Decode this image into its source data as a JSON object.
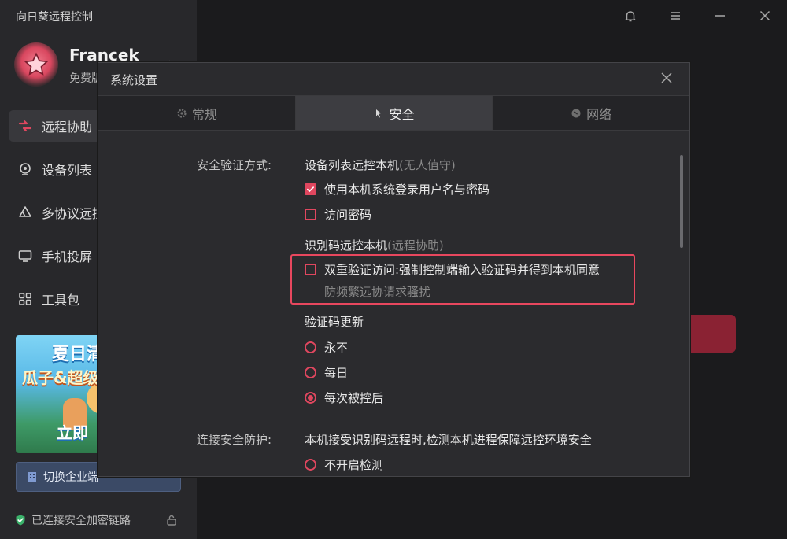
{
  "app": {
    "title": "向日葵远程控制"
  },
  "user": {
    "name": "Francek",
    "plan": "免费版"
  },
  "nav": [
    {
      "label": "远程协助",
      "icon": "remote-assist-icon",
      "active": true
    },
    {
      "label": "设备列表",
      "icon": "device-list-icon",
      "active": false
    },
    {
      "label": "多协议远控",
      "icon": "multi-protocol-icon",
      "active": false
    },
    {
      "label": "手机投屏",
      "icon": "screen-mirror-icon",
      "active": false
    },
    {
      "label": "工具包",
      "icon": "toolkit-icon",
      "active": false
    }
  ],
  "promo": {
    "line1": "夏日清",
    "line2": "瓜子&超级",
    "line3": "立即"
  },
  "switch_enterprise": {
    "label": "切换企业端"
  },
  "secure_status": {
    "label": "已连接安全加密链路"
  },
  "colors": {
    "accent": "#e0475f",
    "highlight": "#e8475e",
    "sidebar_bg": "#28282b",
    "modal_bg": "#2b2b2e"
  },
  "modal": {
    "title": "系统设置",
    "tabs": [
      {
        "label": "常规",
        "icon": "gear-icon",
        "active": false
      },
      {
        "label": "安全",
        "icon": "security-icon",
        "active": true
      },
      {
        "label": "网络",
        "icon": "globe-icon",
        "active": false
      }
    ],
    "security": {
      "verify_label": "安全验证方式:",
      "device_list_head": "设备列表远控本机",
      "device_list_hint": "(无人值守)",
      "opt_system_login": {
        "label": "使用本机系统登录用户名与密码",
        "checked": true
      },
      "opt_access_password": {
        "label": "访问密码",
        "checked": false
      },
      "code_head": "识别码远控本机",
      "code_hint": "(远程协助)",
      "opt_two_factor": {
        "label": "双重验证访问:强制控制端输入验证码并得到本机同意",
        "checked": false
      },
      "two_factor_hint": "防频繁远协请求骚扰",
      "code_refresh_head": "验证码更新",
      "refresh_options": [
        {
          "label": "永不",
          "selected": false
        },
        {
          "label": "每日",
          "selected": false
        },
        {
          "label": "每次被控后",
          "selected": true
        }
      ],
      "conn_protect_label": "连接安全防护:",
      "conn_protect_desc": "本机接受识别码远程时,检测本机进程保障远控环境安全",
      "conn_options": [
        {
          "label": "不开启检测",
          "selected": false
        }
      ]
    }
  }
}
